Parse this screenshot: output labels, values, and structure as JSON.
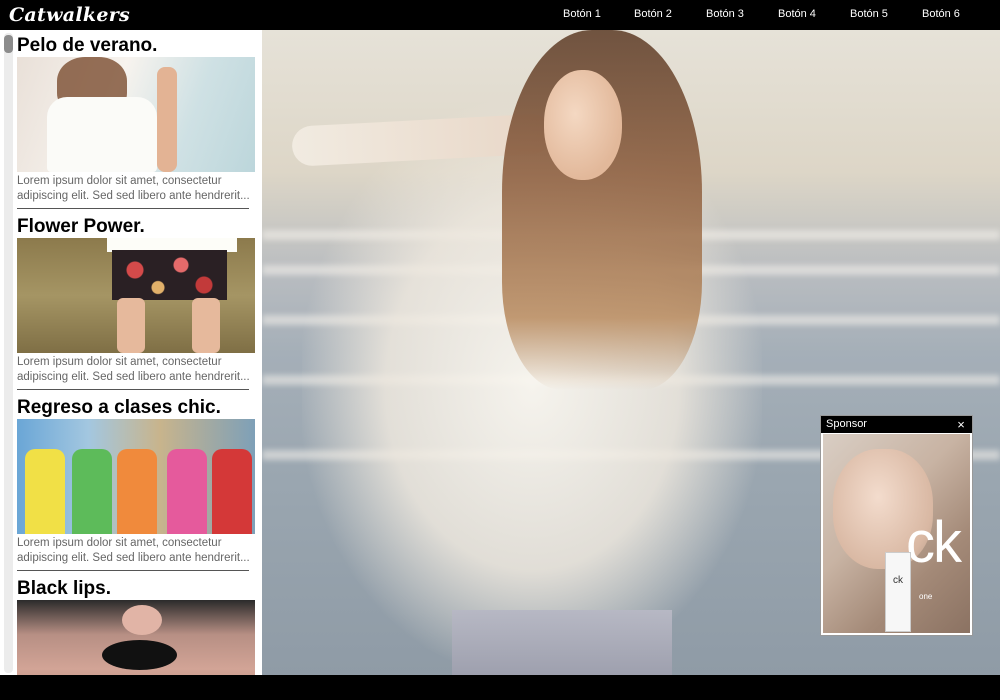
{
  "header": {
    "logo": "Catwalkers",
    "nav": [
      "Botón 1",
      "Botón 2",
      "Botón 3",
      "Botón 4",
      "Botón 5",
      "Botón 6"
    ]
  },
  "sidebar": {
    "articles": [
      {
        "title": "Pelo de verano.",
        "excerpt": "Lorem ipsum dolor sit amet, consectetur adipiscing elit. Sed sed libero ante hendrerit..."
      },
      {
        "title": "Flower Power.",
        "excerpt": "Lorem ipsum dolor sit amet, consectetur adipiscing elit. Sed sed libero ante hendrerit..."
      },
      {
        "title": "Regreso a clases chic.",
        "excerpt": "Lorem ipsum dolor sit amet, consectetur adipiscing elit. Sed sed libero ante hendrerit..."
      },
      {
        "title": "Black lips.",
        "excerpt": ""
      }
    ]
  },
  "sponsor": {
    "label": "Sponsor",
    "close_icon": "×",
    "brand": "ck",
    "bottle_text": "ck",
    "product": "one"
  }
}
